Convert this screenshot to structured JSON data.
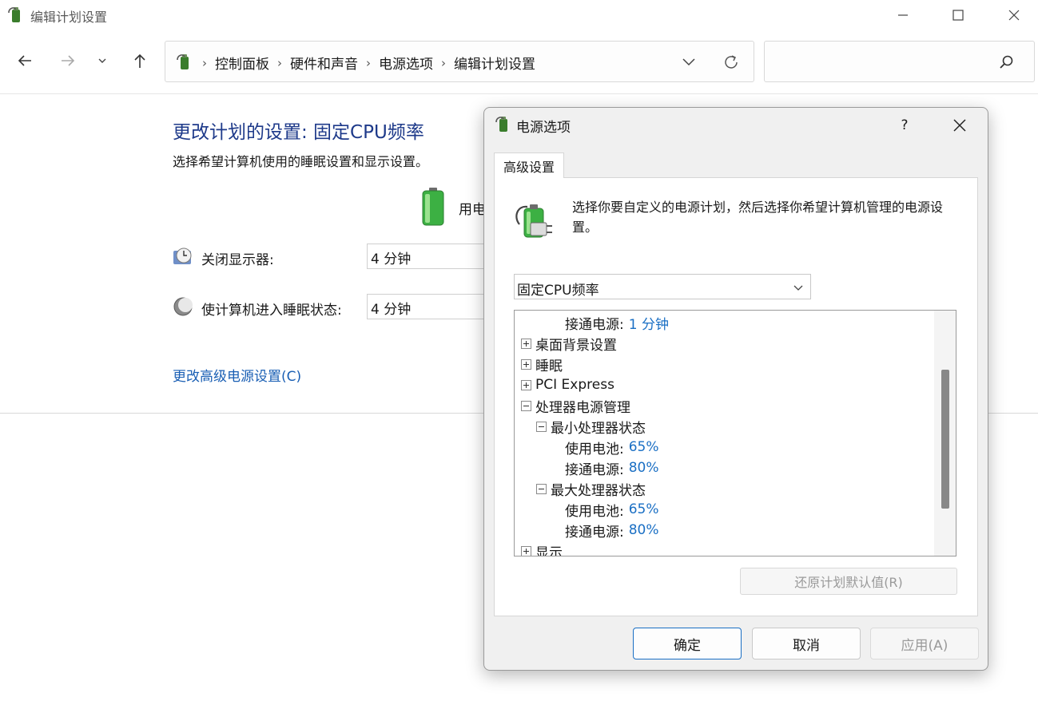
{
  "window": {
    "title": "编辑计划设置"
  },
  "address_bar": {
    "breadcrumbs": [
      "控制面板",
      "硬件和声音",
      "电源选项",
      "编辑计划设置"
    ],
    "separator": "›"
  },
  "search": {
    "placeholder": ""
  },
  "content": {
    "title": "更改计划的设置: 固定CPU频率",
    "subtitle": "选择希望计算机使用的睡眠设置和显示设置。",
    "battery_column_label": "用电",
    "rows": [
      {
        "label": "关闭显示器:",
        "value": "4 分钟"
      },
      {
        "label": "使计算机进入睡眠状态:",
        "value": "4 分钟"
      }
    ],
    "advanced_link": "更改高级电源设置(C)"
  },
  "dialog": {
    "title": "电源选项",
    "help": "?",
    "tab": "高级设置",
    "intro": "选择你要自定义的电源计划，然后选择你希望计算机管理的电源设置。",
    "plan": "固定CPU频率",
    "tree": [
      {
        "level": 2,
        "toggle": "none",
        "label": "接通电源:",
        "value": "1 分钟"
      },
      {
        "level": 0,
        "toggle": "plus",
        "label": "桌面背景设置",
        "value": ""
      },
      {
        "level": 0,
        "toggle": "plus",
        "label": "睡眠",
        "value": ""
      },
      {
        "level": 0,
        "toggle": "plus",
        "label": "PCI Express",
        "value": ""
      },
      {
        "level": 0,
        "toggle": "minus",
        "label": "处理器电源管理",
        "value": ""
      },
      {
        "level": 1,
        "toggle": "minus",
        "label": "最小处理器状态",
        "value": ""
      },
      {
        "level": 2,
        "toggle": "none",
        "label": "使用电池:",
        "value": "65%"
      },
      {
        "level": 2,
        "toggle": "none",
        "label": "接通电源:",
        "value": "80%"
      },
      {
        "level": 1,
        "toggle": "minus",
        "label": "最大处理器状态",
        "value": ""
      },
      {
        "level": 2,
        "toggle": "none",
        "label": "使用电池:",
        "value": "65%"
      },
      {
        "level": 2,
        "toggle": "none",
        "label": "接通电源:",
        "value": "80%"
      },
      {
        "level": 0,
        "toggle": "plus",
        "label": "显示",
        "value": ""
      }
    ],
    "restore_button": "还原计划默认值(R)",
    "ok_button": "确定",
    "cancel_button": "取消",
    "apply_button": "应用(A)"
  },
  "colors": {
    "title_blue": "#1e3a8a",
    "link_blue": "#1a5fb4",
    "value_blue": "#1a6fc4",
    "battery_green": "#3cb043"
  },
  "icons": [
    "power-options-icon",
    "back-arrow-icon",
    "forward-arrow-icon",
    "chevron-down-icon",
    "up-arrow-icon",
    "refresh-icon",
    "search-icon",
    "minimize-icon",
    "maximize-icon",
    "close-icon",
    "battery-icon",
    "clock-monitor-icon",
    "moon-sleep-icon",
    "plug-icon"
  ]
}
